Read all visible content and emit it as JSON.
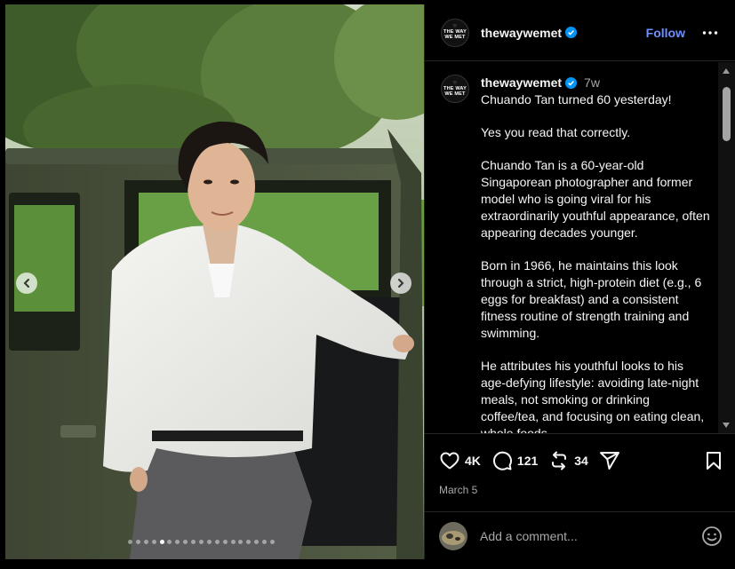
{
  "account": {
    "username": "thewaywemet",
    "logo_lines": [
      "THE WAY",
      "WE MET"
    ],
    "logo_symbol": "♡",
    "follow_label": "Follow"
  },
  "caption": {
    "username": "thewaywemet",
    "time_ago": "7w",
    "paragraphs": [
      "Chuando Tan turned 60 yesterday!",
      "Yes you read that correctly.",
      "Chuando Tan is a 60-year-old Singaporean photographer and former model who is going viral for his extraordinarily youthful appearance, often appearing decades younger.",
      "Born in 1966, he maintains this look through a strict, high-protein diet (e.g., 6 eggs for breakfast) and a consistent fitness routine of strength training and swimming.",
      "He attributes his youthful looks to his age-defying lifestyle: avoiding late-night meals, not smoking or drinking coffee/tea, and focusing on eating clean, whole foods."
    ]
  },
  "actions": {
    "likes": "4K",
    "comments": "121",
    "reposts": "34"
  },
  "post_date": "March 5",
  "comment_box": {
    "placeholder": "Add a comment..."
  },
  "carousel": {
    "slide_count": 19,
    "active_index": 4
  },
  "icons": {
    "verified": "verified-badge-icon",
    "more": "more-options-icon",
    "like": "heart-icon",
    "comment": "comment-bubble-icon",
    "repost": "repost-icon",
    "share": "send-icon",
    "save": "bookmark-icon",
    "emoji": "emoji-icon",
    "prev": "chevron-left-icon",
    "next": "chevron-right-icon"
  },
  "colors": {
    "accent": "#6e8fff",
    "verified": "#0095f6",
    "background": "#000000",
    "secondary_text": "#a8a8a8"
  }
}
